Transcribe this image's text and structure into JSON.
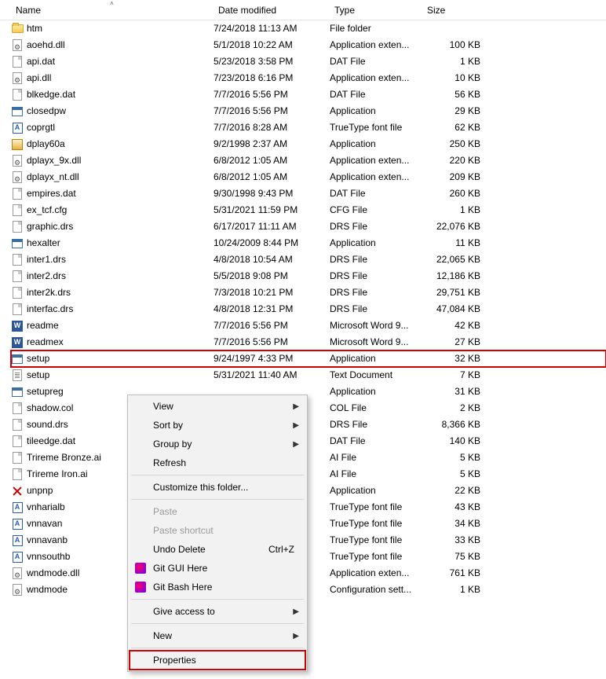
{
  "columns": {
    "name": "Name",
    "date": "Date modified",
    "type": "Type",
    "size": "Size"
  },
  "files": [
    {
      "icon": "folder",
      "name": "htm",
      "date": "7/24/2018 11:13 AM",
      "type": "File folder",
      "size": ""
    },
    {
      "icon": "gear",
      "name": "aoehd.dll",
      "date": "5/1/2018 10:22 AM",
      "type": "Application exten...",
      "size": "100 KB"
    },
    {
      "icon": "page",
      "name": "api.dat",
      "date": "5/23/2018 3:58 PM",
      "type": "DAT File",
      "size": "1 KB"
    },
    {
      "icon": "gear",
      "name": "api.dll",
      "date": "7/23/2018 6:16 PM",
      "type": "Application exten...",
      "size": "10 KB"
    },
    {
      "icon": "page",
      "name": "blkedge.dat",
      "date": "7/7/2016 5:56 PM",
      "type": "DAT File",
      "size": "56 KB"
    },
    {
      "icon": "exe",
      "name": "closedpw",
      "date": "7/7/2016 5:56 PM",
      "type": "Application",
      "size": "29 KB"
    },
    {
      "icon": "ttf",
      "name": "coprgtl",
      "date": "7/7/2016 8:28 AM",
      "type": "TrueType font file",
      "size": "62 KB"
    },
    {
      "icon": "pkg",
      "name": "dplay60a",
      "date": "9/2/1998 2:37 AM",
      "type": "Application",
      "size": "250 KB"
    },
    {
      "icon": "gear",
      "name": "dplayx_9x.dll",
      "date": "6/8/2012 1:05 AM",
      "type": "Application exten...",
      "size": "220 KB"
    },
    {
      "icon": "gear",
      "name": "dplayx_nt.dll",
      "date": "6/8/2012 1:05 AM",
      "type": "Application exten...",
      "size": "209 KB"
    },
    {
      "icon": "page",
      "name": "empires.dat",
      "date": "9/30/1998 9:43 PM",
      "type": "DAT File",
      "size": "260 KB"
    },
    {
      "icon": "page",
      "name": "ex_tcf.cfg",
      "date": "5/31/2021 11:59 PM",
      "type": "CFG File",
      "size": "1 KB"
    },
    {
      "icon": "page",
      "name": "graphic.drs",
      "date": "6/17/2017 11:11 AM",
      "type": "DRS File",
      "size": "22,076 KB"
    },
    {
      "icon": "exe",
      "name": "hexalter",
      "date": "10/24/2009 8:44 PM",
      "type": "Application",
      "size": "11 KB"
    },
    {
      "icon": "page",
      "name": "inter1.drs",
      "date": "4/8/2018 10:54 AM",
      "type": "DRS File",
      "size": "22,065 KB"
    },
    {
      "icon": "page",
      "name": "inter2.drs",
      "date": "5/5/2018 9:08 PM",
      "type": "DRS File",
      "size": "12,186 KB"
    },
    {
      "icon": "page",
      "name": "inter2k.drs",
      "date": "7/3/2018 10:21 PM",
      "type": "DRS File",
      "size": "29,751 KB"
    },
    {
      "icon": "page",
      "name": "interfac.drs",
      "date": "4/8/2018 12:31 PM",
      "type": "DRS File",
      "size": "47,084 KB"
    },
    {
      "icon": "word",
      "name": "readme",
      "date": "7/7/2016 5:56 PM",
      "type": "Microsoft Word 9...",
      "size": "42 KB"
    },
    {
      "icon": "word",
      "name": "readmex",
      "date": "7/7/2016 5:56 PM",
      "type": "Microsoft Word 9...",
      "size": "27 KB"
    },
    {
      "icon": "setup",
      "name": "setup",
      "date": "9/24/1997 4:33 PM",
      "type": "Application",
      "size": "32 KB",
      "highlighted": true
    },
    {
      "icon": "txt",
      "name": "setup",
      "date": "5/31/2021 11:40 AM",
      "type": "Text Document",
      "size": "7 KB"
    },
    {
      "icon": "setup",
      "name": "setupreg",
      "date": "",
      "type": "Application",
      "size": "31 KB"
    },
    {
      "icon": "page",
      "name": "shadow.col",
      "date": "",
      "type": "COL File",
      "size": "2 KB"
    },
    {
      "icon": "page",
      "name": "sound.drs",
      "date": "",
      "type": "DRS File",
      "size": "8,366 KB"
    },
    {
      "icon": "page",
      "name": "tileedge.dat",
      "date": "",
      "type": "DAT File",
      "size": "140 KB"
    },
    {
      "icon": "ai",
      "name": "Trireme Bronze.ai",
      "date": "",
      "type": "AI File",
      "size": "5 KB"
    },
    {
      "icon": "ai",
      "name": "Trireme Iron.ai",
      "date": "",
      "type": "AI File",
      "size": "5 KB"
    },
    {
      "icon": "x",
      "name": "unpnp",
      "date": "",
      "type": "Application",
      "size": "22 KB"
    },
    {
      "icon": "ttf",
      "name": "vnharialb",
      "date": "",
      "type": "TrueType font file",
      "size": "43 KB"
    },
    {
      "icon": "ttf",
      "name": "vnnavan",
      "date": "",
      "type": "TrueType font file",
      "size": "34 KB"
    },
    {
      "icon": "ttf",
      "name": "vnnavanb",
      "date": "",
      "type": "TrueType font file",
      "size": "33 KB"
    },
    {
      "icon": "ttf",
      "name": "vnnsouthb",
      "date": "",
      "type": "TrueType font file",
      "size": "75 KB"
    },
    {
      "icon": "gear",
      "name": "wndmode.dll",
      "date": "",
      "type": "Application exten...",
      "size": "761 KB"
    },
    {
      "icon": "gear",
      "name": "wndmode",
      "date": "",
      "type": "Configuration sett...",
      "size": "1 KB"
    }
  ],
  "context_menu": {
    "view": "View",
    "sort_by": "Sort by",
    "group_by": "Group by",
    "refresh": "Refresh",
    "customize": "Customize this folder...",
    "paste": "Paste",
    "paste_shortcut": "Paste shortcut",
    "undo_delete": "Undo Delete",
    "undo_shortcut": "Ctrl+Z",
    "git_gui": "Git GUI Here",
    "git_bash": "Git Bash Here",
    "give_access": "Give access to",
    "new": "New",
    "properties": "Properties"
  }
}
